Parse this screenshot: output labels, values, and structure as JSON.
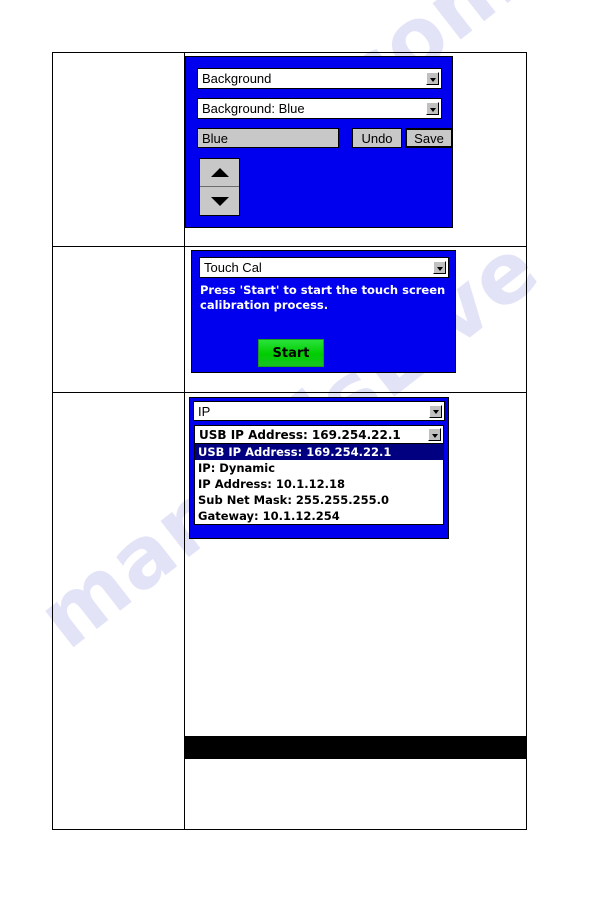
{
  "watermark": {
    "line_1": "manualsLive",
    "line_2": ".com"
  },
  "panels": [
    {
      "id": "background",
      "title_combo": {
        "value": "Background",
        "arrow_icon": "chevron-down-icon"
      },
      "detail_combo": {
        "value": "Background: Blue",
        "arrow_icon": "chevron-down-icon"
      },
      "value_field": {
        "value": "Blue"
      },
      "undo_label": "Undo",
      "save_label": "Save",
      "spinner": {
        "up_icon": "triangle-up-icon",
        "down_icon": "triangle-down-icon"
      }
    },
    {
      "id": "touch-cal",
      "title_combo": {
        "value": "Touch Cal",
        "arrow_icon": "chevron-down-icon"
      },
      "message": "Press 'Start' to start the touch screen calibration process.",
      "start_label": "Start"
    },
    {
      "id": "ip",
      "title_combo": {
        "value": "IP",
        "arrow_icon": "chevron-down-icon"
      },
      "selected_combo": {
        "value": "USB IP Address: 169.254.22.1",
        "arrow_icon": "chevron-down-icon"
      },
      "options": [
        {
          "label": "USB IP Address: 169.254.22.1",
          "selected": true
        },
        {
          "label": "IP: Dynamic",
          "selected": false
        },
        {
          "label": "IP Address: 10.1.12.18",
          "selected": false
        },
        {
          "label": "Sub Net Mask: 255.255.255.0",
          "selected": false
        },
        {
          "label": "Gateway: 10.1.12.254",
          "selected": false
        }
      ]
    }
  ],
  "colors": {
    "screen_blue": "#0000EE",
    "selection_navy": "#000080",
    "button_green": "#00CC00",
    "control_gray": "#C8C8C8",
    "bar_black": "#000000"
  }
}
